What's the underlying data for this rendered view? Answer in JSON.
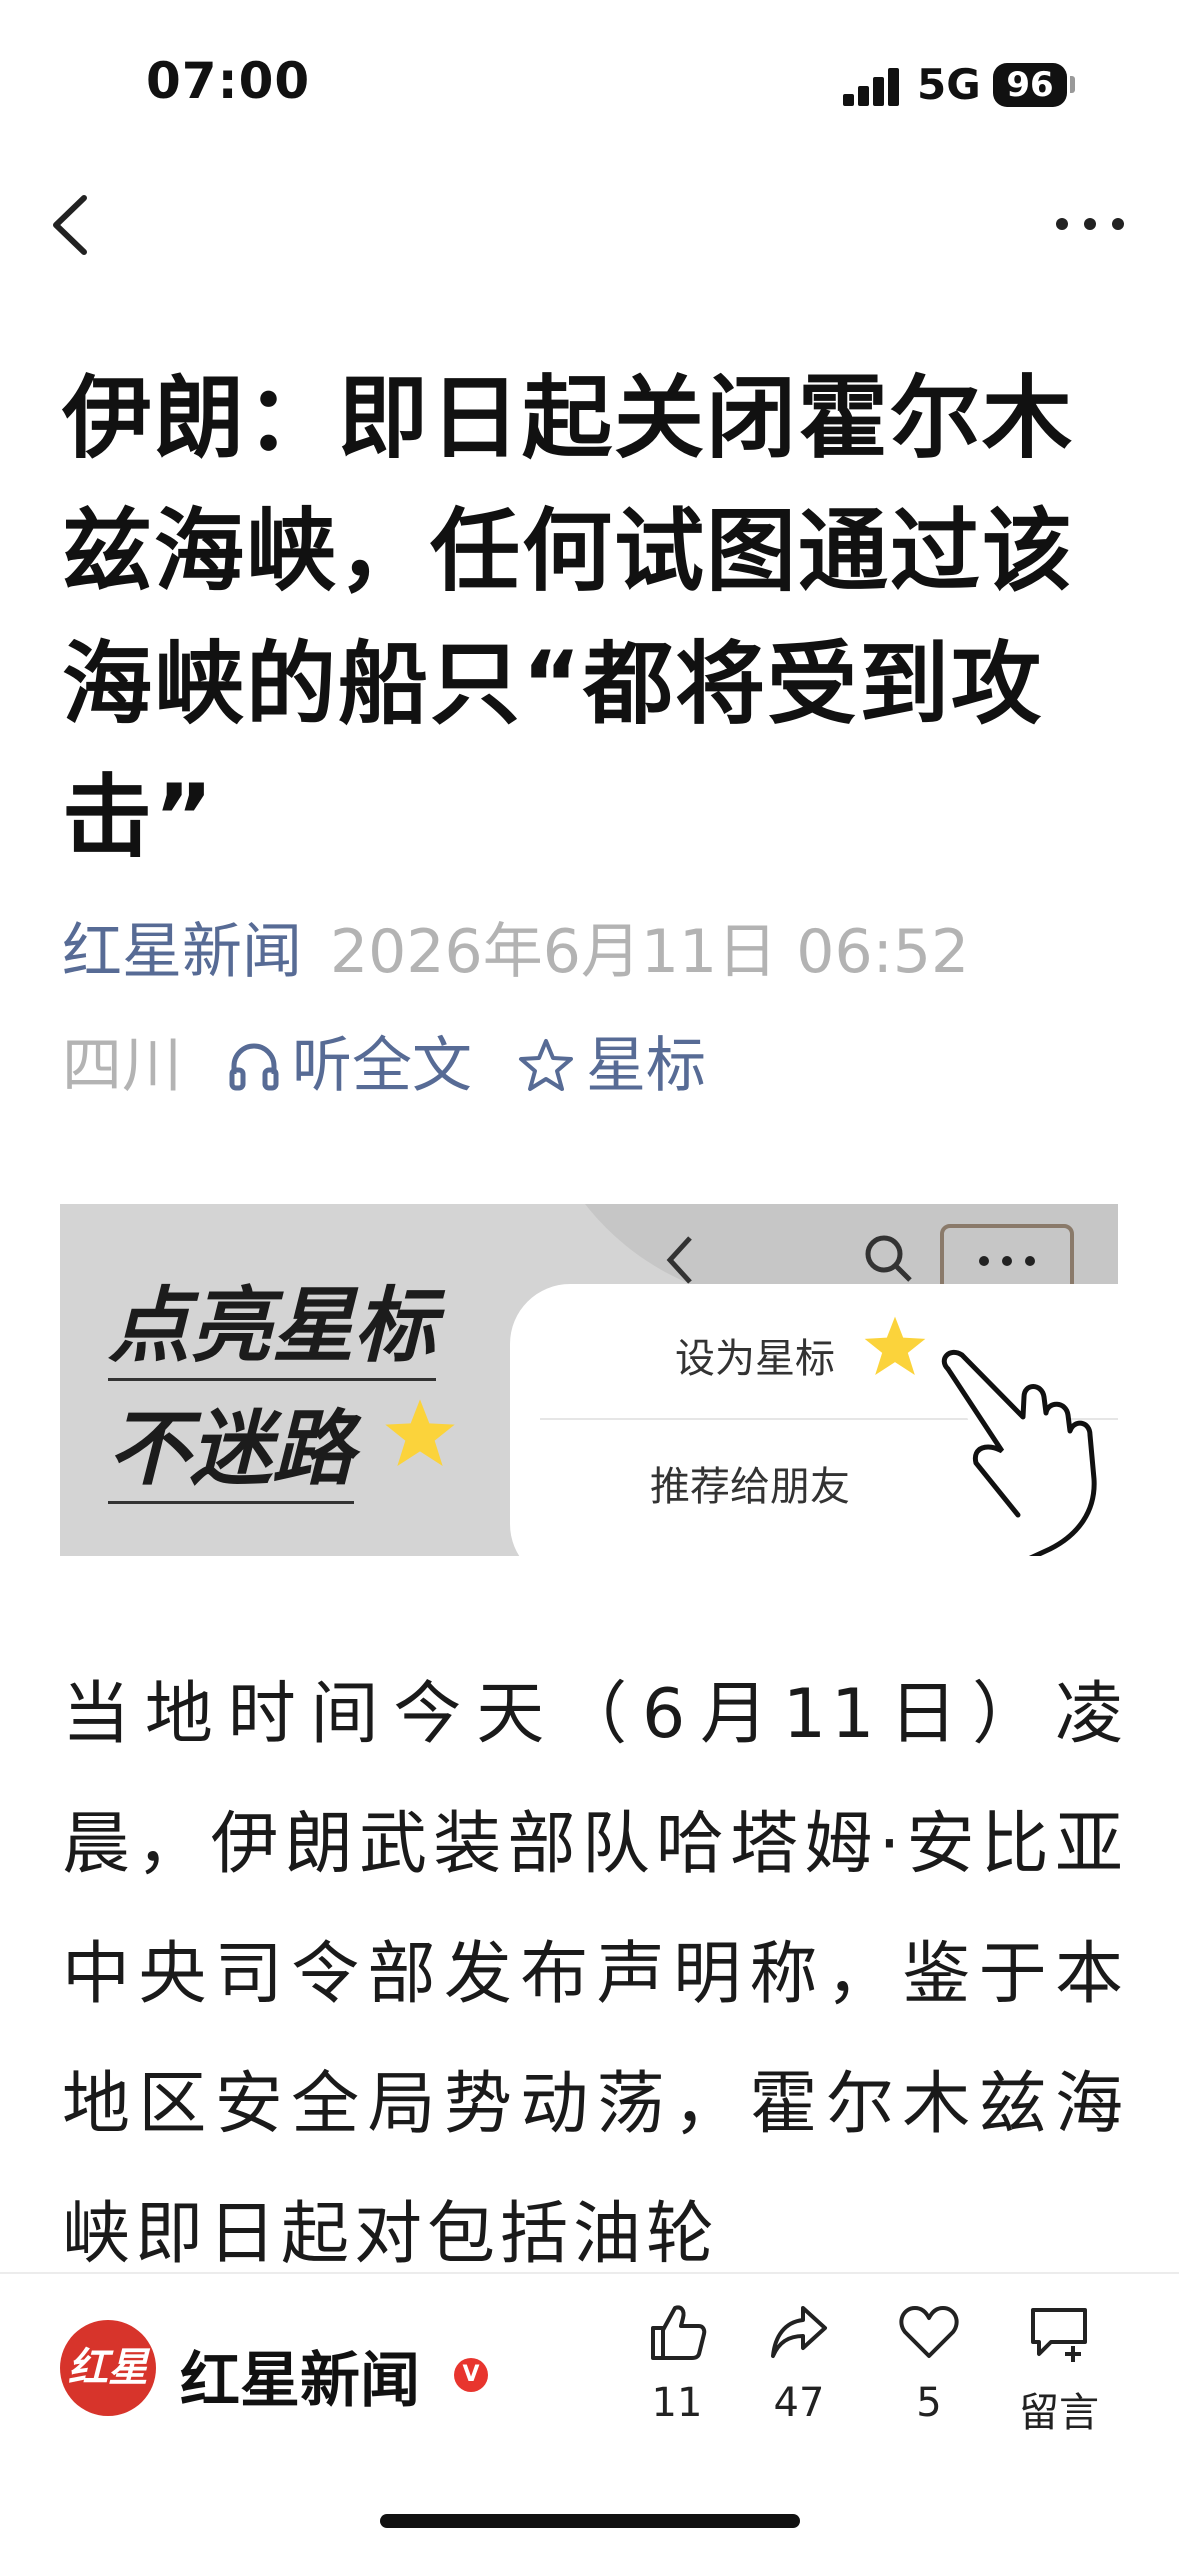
{
  "status_bar": {
    "time": "07:00",
    "network": "5G",
    "battery": "96",
    "icons": [
      "signal-icon",
      "battery-icon"
    ]
  },
  "nav": {
    "icons": [
      "back-arrow-icon",
      "more-icon"
    ]
  },
  "article": {
    "title": "伊朗：即日起关闭霍尔木兹海峡，任何试图通过该海峡的船只“都将受到攻击”",
    "source": "红星新闻",
    "date": "2026年6月11日 06:52",
    "location": "四川",
    "listen_label": "听全文",
    "star_label": "星标",
    "body": "当地时间今天（6月11日）凌晨，伊朗武装部队哈塔姆·安比亚中央司令部发布声明称，鉴于本地区安全局势动荡，霍尔木兹海峡即日起对包括油轮"
  },
  "banner": {
    "slogan_line1": "点亮星标",
    "slogan_line2": "不迷路",
    "menu_item1": "设为星标",
    "menu_item2": "推荐给朋友",
    "icons": [
      "back-arrow-icon",
      "search-icon",
      "more-icon",
      "star-icon",
      "hand-pointer-icon"
    ]
  },
  "bottom_bar": {
    "account_logo_text": "红星",
    "account_name": "红星新闻",
    "verified_mark": "V",
    "like_count": "11",
    "share_count": "47",
    "favorite_count": "5",
    "comment_label": "留言",
    "icons": [
      "thumbs-up-icon",
      "share-icon",
      "heart-icon",
      "comment-icon"
    ]
  },
  "colors": {
    "link": "#576b95",
    "muted": "#b3b3b3",
    "brand_red": "#d7342b"
  }
}
